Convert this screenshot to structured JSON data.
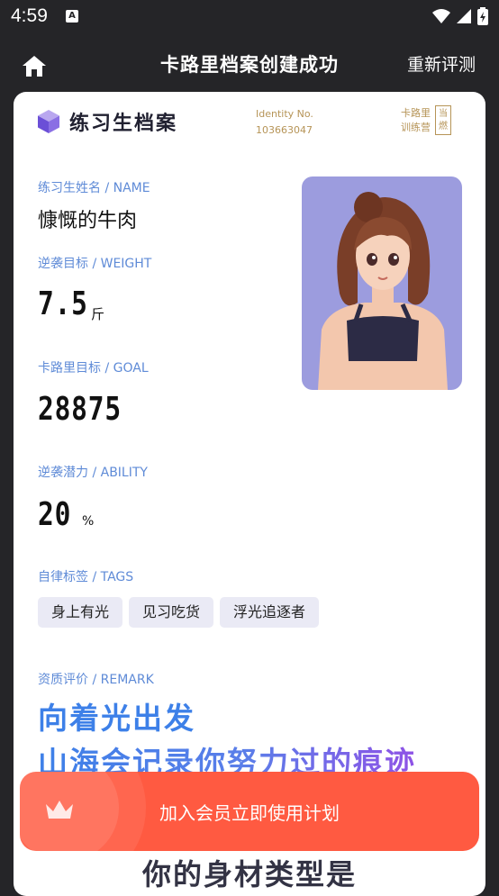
{
  "status": {
    "time": "4:59",
    "notif_glyph": "A"
  },
  "header": {
    "title": "卡路里档案创建成功",
    "reeval_label": "重新评测"
  },
  "brand": {
    "title": "练习生档案",
    "identity_label": "Identity No.",
    "identity_no": "103663047",
    "stamp_line1": "卡路里",
    "stamp_line2": "训练营",
    "stamp_box_line1": "当",
    "stamp_box_line2": "燃"
  },
  "fields": {
    "name_label": "练习生姓名 / NAME",
    "name_value": "慷慨的牛肉",
    "weight_label": "逆袭目标 / WEIGHT",
    "weight_value": "7.5",
    "weight_unit": "斤",
    "goal_label": "卡路里目标 / GOAL",
    "goal_value": "28875",
    "ability_label": "逆袭潜力 / ABILITY",
    "ability_value": "20",
    "ability_unit": "%",
    "tags_label": "自律标签 / TAGS",
    "tags": [
      "身上有光",
      "见习吃货",
      "浮光追逐者"
    ],
    "remark_label": "资质评价 / REMARK",
    "remark_line1": "向着光出发",
    "remark_line2": "山海会记录你努力过的痕迹"
  },
  "cta": {
    "label": "加入会员立即使用计划"
  },
  "next_section": {
    "title": "你的身材类型是"
  },
  "colors": {
    "accent_blue": "#3d80e8",
    "gold": "#b69457",
    "cta": "#ff5a41",
    "avatar_bg": "#9c9cde"
  }
}
